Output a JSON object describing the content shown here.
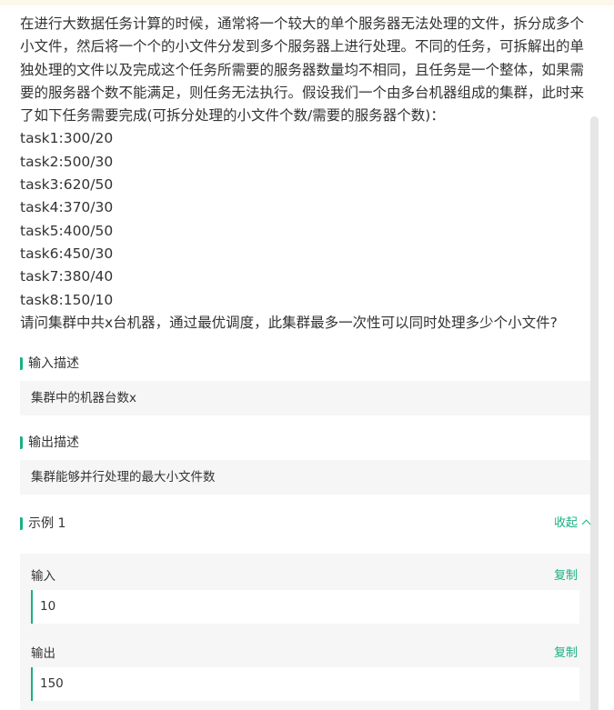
{
  "problem": {
    "intro": "在进行大数据任务计算的时候，通常将一个较大的单个服务器无法处理的文件，拆分成多个小文件，然后将一个个的小文件分发到多个服务器上进行处理。不同的任务，可拆解出的单独处理的文件以及完成这个任务所需要的服务器数量均不相同，且任务是一个整体，如果需要的服务器个数不能满足，则任务无法执行。假设我们一个由多台机器组成的集群，此时来了如下任务需要完成(可拆分处理的小文件个数/需要的服务器个数)：",
    "tasks": [
      "task1:300/20",
      "task2:500/30",
      "task3:620/50",
      "task4:370/30",
      "task5:400/50",
      "task6:450/30",
      "task7:380/40",
      "task8:150/10"
    ],
    "question": "请问集群中共x台机器，通过最优调度，此集群最多一次性可以同时处理多少个小文件?"
  },
  "input_section": {
    "title": "输入描述",
    "content": "集群中的机器台数x"
  },
  "output_section": {
    "title": "输出描述",
    "content": "集群能够并行处理的最大小文件数"
  },
  "example": {
    "title": "示例 1",
    "collapse_label": "收起",
    "input_label": "输入",
    "input_value": "10",
    "output_label": "输出",
    "output_value": "150",
    "copy_label": "复制"
  },
  "colors": {
    "accent": "#19b083",
    "panel_bg": "#f6f6f6",
    "text": "#333333"
  }
}
